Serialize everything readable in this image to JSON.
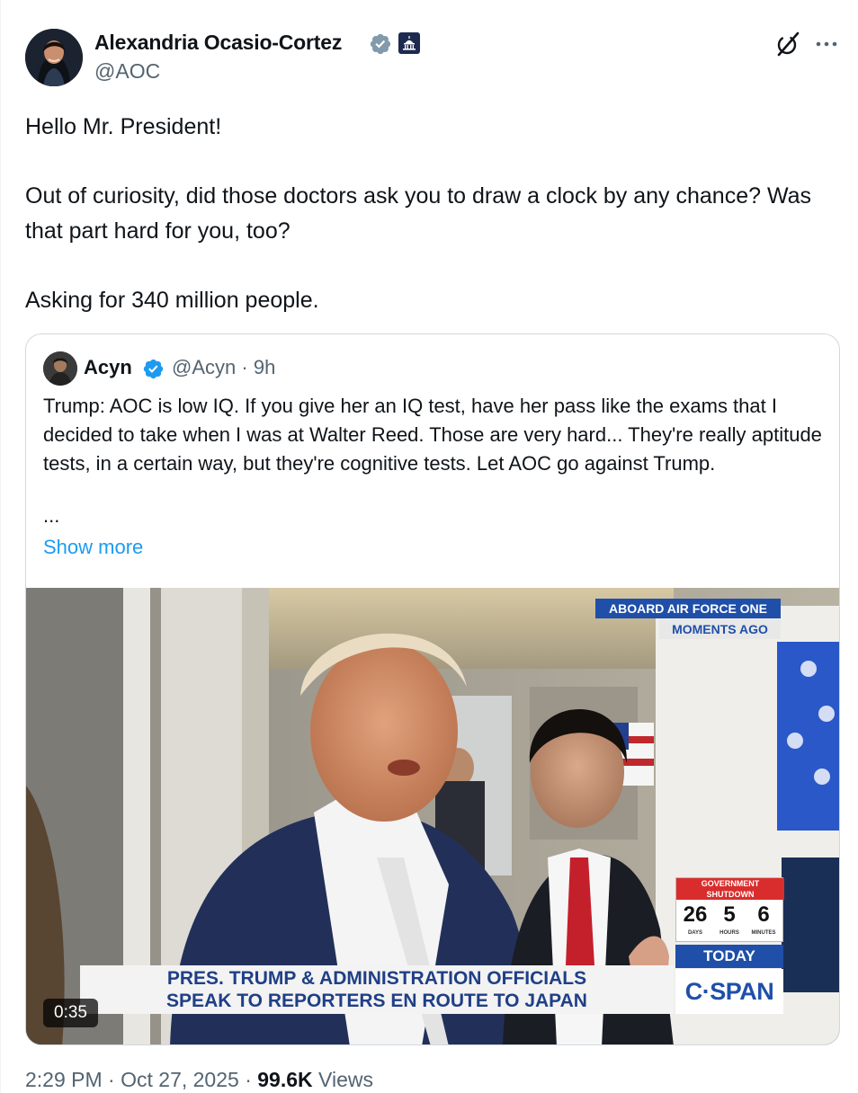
{
  "author": {
    "name": "Alexandria Ocasio-Cortez",
    "handle": "@AOC",
    "verified_color": "#829aab",
    "badge_icon": "capitol-building-icon"
  },
  "header_actions": {
    "grok_icon": "grok-icon",
    "more_icon": "more-dots-icon"
  },
  "tweet": {
    "text": "Hello Mr. President!\n\nOut of curiosity, did those doctors ask you to draw a clock by any chance? Was that part hard for you, too?\n\nAsking for 340 million people."
  },
  "quote": {
    "name": "Acyn",
    "handle": "@Acyn",
    "separator": "·",
    "time": "9h",
    "verified_color": "#1d9bf0",
    "text": "Trump: AOC is low IQ. If you give her an IQ test, have her pass like the exams that I decided to take when I was at Walter Reed. Those are very hard... They're really aptitude tests, in a certain way, but they're cognitive tests. Let AOC go against Trump.",
    "ellipsis": "...",
    "show_more": "Show more",
    "video": {
      "duration": "0:35",
      "tag_top": "ABOARD AIR FORCE ONE",
      "tag_bottom": "MOMENTS AGO",
      "chyron_line1": "PRES. TRUMP & ADMINISTRATION OFFICIALS",
      "chyron_line2": "SPEAK TO REPORTERS EN ROUTE TO JAPAN",
      "shutdown_title_1": "GOVERNMENT",
      "shutdown_title_2": "SHUTDOWN",
      "days": "26",
      "hours": "5",
      "minutes": "6",
      "days_label": "DAYS",
      "hours_label": "HOURS",
      "minutes_label": "MINUTES",
      "today": "TODAY",
      "network": "C·SPAN"
    }
  },
  "footer": {
    "time": "2:29 PM",
    "dot1": "·",
    "date": "Oct 27, 2025",
    "dot2": "·",
    "views_count": "99.6K",
    "views_label": "Views"
  }
}
